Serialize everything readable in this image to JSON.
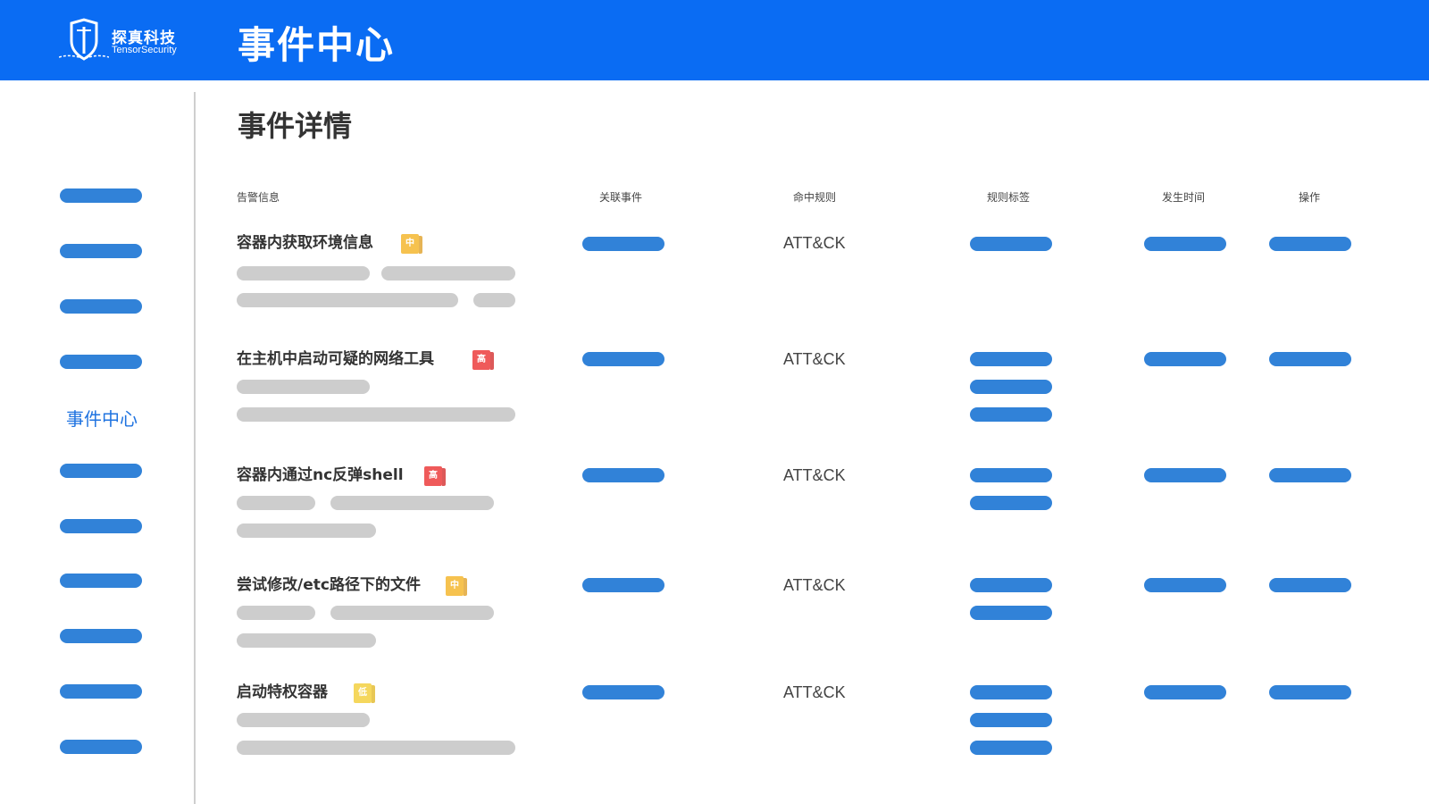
{
  "header": {
    "company_cn": "探真科技",
    "company_en": "TensorSecurity",
    "logo_icon": "shield-ship-logo",
    "app_title": "事件中心",
    "bg_color": "#0a6cf3"
  },
  "sidebar": {
    "active_label": "事件中心",
    "pill_color": "#3182d8"
  },
  "main": {
    "page_title": "事件详情",
    "columns": [
      "告警信息",
      "关联事件",
      "命中规则",
      "规则标签",
      "发生时间",
      "操作"
    ],
    "rows": [
      {
        "name": "容器内获取环境信息",
        "severity": "中",
        "rule": "ATT&CK",
        "tag_count": 1
      },
      {
        "name": "在主机中启动可疑的网络工具",
        "severity": "高",
        "rule": "ATT&CK",
        "tag_count": 3
      },
      {
        "name": "容器内通过nc反弹shell",
        "severity": "高",
        "rule": "ATT&CK",
        "tag_count": 2
      },
      {
        "name": "尝试修改/etc路径下的文件",
        "severity": "中",
        "rule": "ATT&CK",
        "tag_count": 2
      },
      {
        "name": "启动特权容器",
        "severity": "低",
        "rule": "ATT&CK",
        "tag_count": 3
      }
    ]
  },
  "colors": {
    "severity_mid": "#f6c24f",
    "severity_high": "#ef5a5a",
    "severity_low": "#f5d75d",
    "placeholder_gray": "#cdcdcd",
    "accent_blue": "#3182d8"
  }
}
